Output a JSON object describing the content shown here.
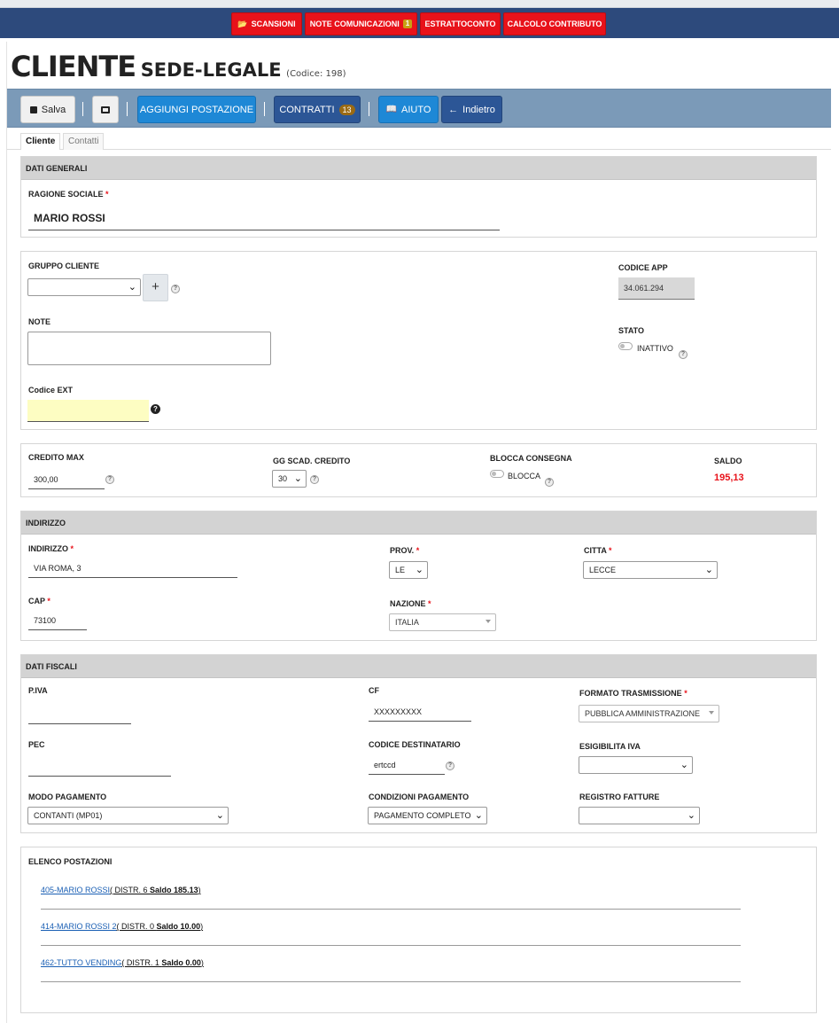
{
  "topnav": {
    "scansioni": "SCANSIONI",
    "note_label": "NOTE COMUNICAZIONI",
    "note_count": "1",
    "estratto": "ESTRATTOCONTO",
    "calcolo": "CALCOLO CONTRIBUTO"
  },
  "header": {
    "title": "CLIENTE",
    "subtitle": "SEDE-LEGALE",
    "code": "(Codice: 198)"
  },
  "toolbar": {
    "salva": "Salva",
    "aggiungi": "AGGIUNGI POSTAZIONE",
    "contratti": "CONTRATTI",
    "contratti_count": "13",
    "aiuto": "AIUTO",
    "indietro": "Indietro"
  },
  "tabs": {
    "cliente": "Cliente",
    "contatti": "Contatti"
  },
  "dati_generali": {
    "heading": "DATI GENERALI",
    "ragione_label": "RAGIONE SOCIALE",
    "ragione_value": "MARIO ROSSI"
  },
  "gruppo": {
    "gruppo_label": "GRUPPO CLIENTE",
    "gruppo_value": "",
    "plus": "+",
    "note_label": "NOTE",
    "note_value": "",
    "codext_label": "Codice EXT",
    "codext_value": "",
    "codapp_label": "CODICE APP",
    "codapp_value": "34.061.294",
    "stato_label": "STATO",
    "stato_value": "INATTIVO"
  },
  "credito": {
    "max_label": "CREDITO MAX",
    "max_value": "300,00",
    "gg_label": "GG SCAD. CREDITO",
    "gg_value": "30",
    "blocca_label": "BLOCCA CONSEGNA",
    "blocca_value": "BLOCCA",
    "saldo_label": "SALDO",
    "saldo_value": "195,13"
  },
  "indirizzo": {
    "heading": "INDIRIZZO",
    "ind_label": "INDIRIZZO",
    "ind_value": "VIA ROMA, 3",
    "prov_label": "PROV.",
    "prov_value": "LE",
    "citta_label": "CITTA",
    "citta_value": "LECCE",
    "cap_label": "CAP",
    "cap_value": "73100",
    "naz_label": "NAZIONE",
    "naz_value": "ITALIA"
  },
  "fiscali": {
    "heading": "DATI FISCALI",
    "piva_label": "P.IVA",
    "piva_value": "",
    "cf_label": "CF",
    "cf_value": "XXXXXXXXX",
    "formato_label": "FORMATO TRASMISSIONE",
    "formato_value": "PUBBLICA AMMINISTRAZIONE",
    "pec_label": "PEC",
    "pec_value": "",
    "coddest_label": "CODICE DESTINATARIO",
    "coddest_value": "ertccd",
    "esig_label": "ESIGIBILITA IVA",
    "esig_value": "",
    "modo_label": "MODO PAGAMENTO",
    "modo_value": "CONTANTI (MP01)",
    "cond_label": "CONDIZIONI PAGAMENTO",
    "cond_value": "PAGAMENTO COMPLETO",
    "registro_label": "REGISTRO FATTURE",
    "registro_value": ""
  },
  "postazioni": {
    "heading": "ELENCO POSTAZIONI",
    "items": [
      {
        "link": "405-MARIO ROSSI",
        "distr": "( DISTR. 6 ",
        "saldo": "Saldo 185.13",
        "close": ")"
      },
      {
        "link": "414-MARIO ROSSI 2",
        "distr": "( DISTR. 0 ",
        "saldo": "Saldo 10.00",
        "close": ")"
      },
      {
        "link": "462-TUTTO VENDING",
        "distr": "( DISTR. 1 ",
        "saldo": "Saldo 0.00",
        "close": ")"
      }
    ]
  },
  "colors": {
    "navbar": "#2d4a7c",
    "red": "#e8121a",
    "toolbar": "#7b9ab8",
    "blue": "#1e88d6",
    "navy": "#2c5696",
    "saldo": "#e8121a"
  }
}
